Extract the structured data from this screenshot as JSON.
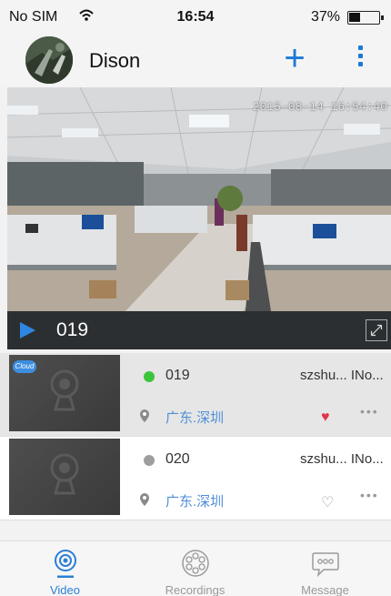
{
  "status_bar": {
    "carrier": "No SIM",
    "time": "16:54",
    "battery_percent": "37%"
  },
  "header": {
    "username": "Dison",
    "add_label": "+"
  },
  "live_view": {
    "timestamp": "2015-08-14 16:54:40",
    "camera_name": "019"
  },
  "devices": [
    {
      "name": "019",
      "user": "szshu... INo...",
      "location": "广东.深圳",
      "status": "online",
      "favorite": true,
      "cloud_badge": "Cloud",
      "more": "•••"
    },
    {
      "name": "020",
      "user": "szshu... INo...",
      "location": "广东.深圳",
      "status": "offline",
      "favorite": false,
      "more": "•••"
    }
  ],
  "tabs": [
    {
      "label": "Video",
      "icon": "camera-icon",
      "active": true
    },
    {
      "label": "Recordings",
      "icon": "film-reel-icon",
      "active": false
    },
    {
      "label": "Message",
      "icon": "chat-bubble-icon",
      "active": false
    }
  ],
  "colors": {
    "accent": "#1a7ad6",
    "online": "#3cc43c",
    "offline": "#9e9e9e",
    "favorite": "#e0344b",
    "location": "#4f8fd8"
  }
}
